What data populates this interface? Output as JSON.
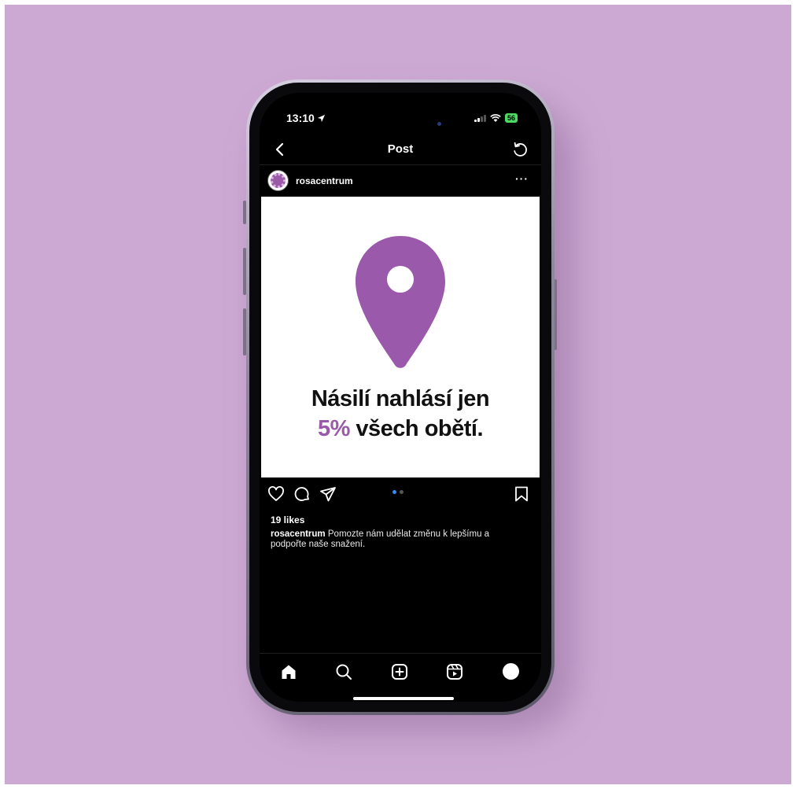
{
  "status_bar": {
    "time": "13:10",
    "battery": "56"
  },
  "header": {
    "title": "Post"
  },
  "post": {
    "username": "rosacentrum",
    "more": "···",
    "headline_line1": "Násilí nahlásí jen",
    "headline_accent": "5%",
    "headline_line2_rest": "všech obětí.",
    "likes": "19 likes",
    "caption_user": "rosacentrum",
    "caption_text": "Pomozte nám udělat změnu k lepšímu a podpořte naše snažení.",
    "carousel_active": 1,
    "carousel_total": 2
  },
  "colors": {
    "background": "#cca9d3",
    "accent": "#9b59ab",
    "carousel_active": "#2d8cff"
  },
  "icons": {
    "header": [
      "back-chevron-icon",
      "refresh-icon"
    ],
    "actions": [
      "heart-icon",
      "comment-icon",
      "share-icon",
      "bookmark-icon"
    ],
    "nav": [
      "home-icon",
      "search-icon",
      "add-post-icon",
      "reels-icon",
      "profile-icon"
    ]
  }
}
